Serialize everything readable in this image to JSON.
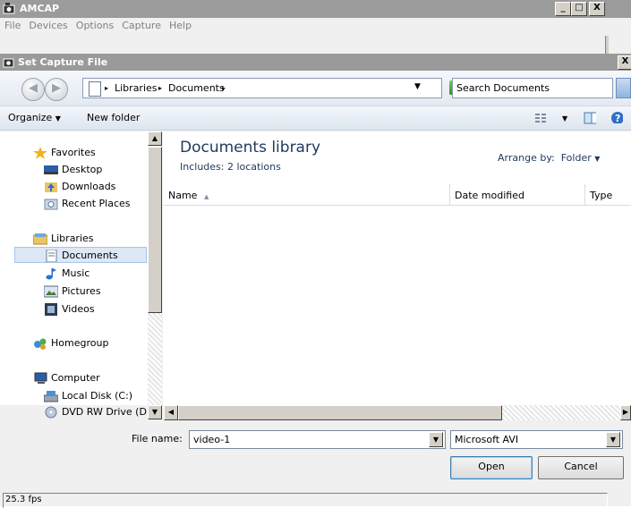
{
  "app": {
    "title": "AMCAP",
    "menu": [
      "File",
      "Devices",
      "Options",
      "Capture",
      "Help"
    ],
    "window_buttons": {
      "minimize": "_",
      "maximize": "□",
      "close": "X"
    },
    "status_text": "25.3 fps"
  },
  "dialog": {
    "title": "Set Capture File",
    "close_label": "X",
    "address": {
      "crumbs": [
        "Libraries",
        "Documents"
      ],
      "separator": "▸"
    },
    "search": {
      "placeholder": "Search Documents"
    },
    "toolbar": {
      "organize": "Organize",
      "new_folder": "New folder"
    },
    "nav": {
      "favorites": {
        "label": "Favorites",
        "items": [
          "Desktop",
          "Downloads",
          "Recent Places"
        ]
      },
      "libraries": {
        "label": "Libraries",
        "items": [
          "Documents",
          "Music",
          "Pictures",
          "Videos"
        ]
      },
      "homegroup": {
        "label": "Homegroup"
      },
      "computer": {
        "label": "Computer",
        "items": [
          "Local Disk (C:)",
          "DVD RW Drive (D:)"
        ]
      }
    },
    "library": {
      "title": "Documents library",
      "includes": "Includes: 2 locations",
      "arrange_label": "Arrange by:",
      "arrange_value": "Folder"
    },
    "columns": {
      "name": "Name",
      "date_modified": "Date modified",
      "type": "Type"
    },
    "filename": {
      "label": "File name:",
      "value": "video-1"
    },
    "filetype": {
      "value": "Microsoft AVI"
    },
    "buttons": {
      "open": "Open",
      "cancel": "Cancel"
    }
  },
  "colors": {
    "title_bar": "#9b9b9b",
    "selection": "#dde8f6",
    "library_title": "#1e395b"
  }
}
